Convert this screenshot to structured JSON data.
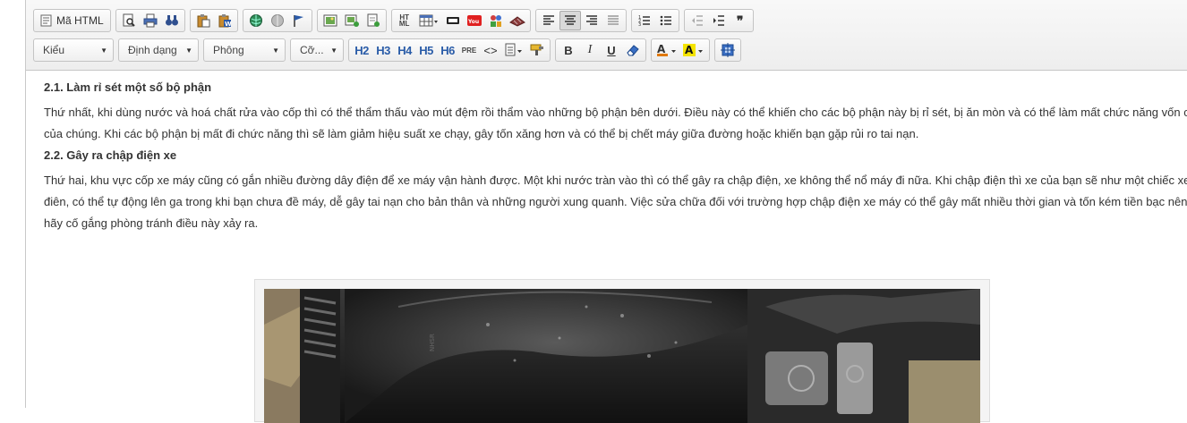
{
  "toolbar": {
    "source_label": "Mã HTML",
    "combos": {
      "style": "Kiểu",
      "format": "Định dạng",
      "font": "Phông",
      "size": "Cỡ..."
    },
    "headings": [
      "H2",
      "H3",
      "H4",
      "H5",
      "H6"
    ],
    "pre_label": "PRE",
    "code_label": "<>",
    "bold_label": "B",
    "italic_label": "I",
    "underline_label": "U",
    "blockquote_label": "❞",
    "ht_label_top": "HT",
    "ht_label_bottom": "ML"
  },
  "article": {
    "h1": "2.1. Làm rỉ sét một số bộ phận",
    "p1": "Thứ nhất, khi dùng nước và hoá chất rửa vào cốp thì có thể thẩm thấu vào mút đệm rồi thẩm vào những bộ phận bên dưới. Điều này có thể khiến cho các bộ phận này bị rỉ sét, bị ăn mòn và có thể làm mất chức năng vốn có của chúng. Khi các bộ phận bị mất đi chức năng thì sẽ làm giảm hiệu suất xe chạy, gây tốn xăng hơn và có thể bị chết máy giữa đường hoặc khiến bạn gặp rủi ro tai nạn.",
    "h2": "2.2. Gây ra chập điện xe",
    "p2": "Thứ hai, khu vực cốp xe máy cũng có gắn nhiều đường dây điện để xe máy vận hành được. Một khi nước tràn vào thì có thể gây ra chập điện, xe không thể nổ máy đi nữa. Khi chập điện thì xe của bạn sẽ như một chiếc xe điên, có thể tự động lên ga trong khi bạn chưa đề máy, dễ gây tai nạn cho bản thân và những người xung quanh. Việc sửa chữa đối với trường hợp chập điện xe máy có thể gây mất nhiều thời gian và tốn kém tiền bạc nên bạn hãy cố gắng phòng tránh điều này xảy ra.",
    "image_text": "NHSR"
  },
  "colors": {
    "heading_blue": "#2a5ca8",
    "toolbar_bg": "#f0f0f0"
  }
}
